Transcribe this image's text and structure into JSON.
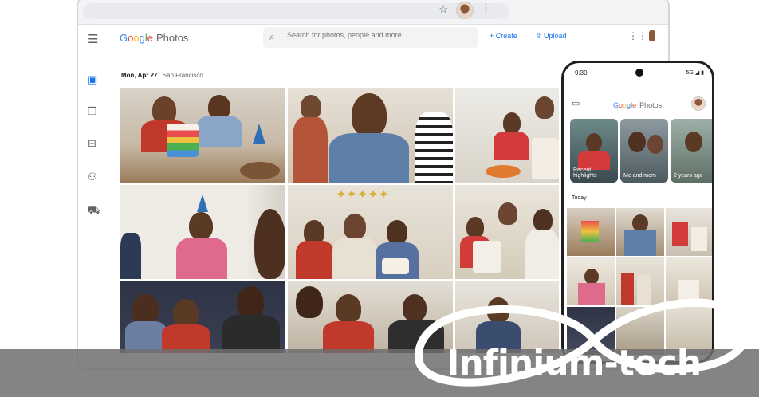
{
  "browser": {
    "star_icon": "star-icon",
    "menu_icon": "kebab-icon"
  },
  "header": {
    "logo_google": [
      "G",
      "o",
      "o",
      "g",
      "l",
      "e"
    ],
    "logo_photos": "Photos",
    "search_placeholder": "Search for photos, people and more",
    "create_label": "+ Create",
    "upload_label": "⇪ Upload"
  },
  "main": {
    "date": "Mon, Apr 27",
    "location": "San Francisco"
  },
  "phone": {
    "time": "9:30",
    "status": "5G ◢ ▮",
    "logo_photos": "Photos",
    "memories": [
      {
        "label": "Recent highlights"
      },
      {
        "label": "Me and mom"
      },
      {
        "label": "2 years ago"
      }
    ],
    "today": "Today"
  },
  "watermark": {
    "text": "Infinium-tech"
  },
  "colors": {
    "accent": "#1a73e8",
    "band": "#6e6e6e"
  }
}
